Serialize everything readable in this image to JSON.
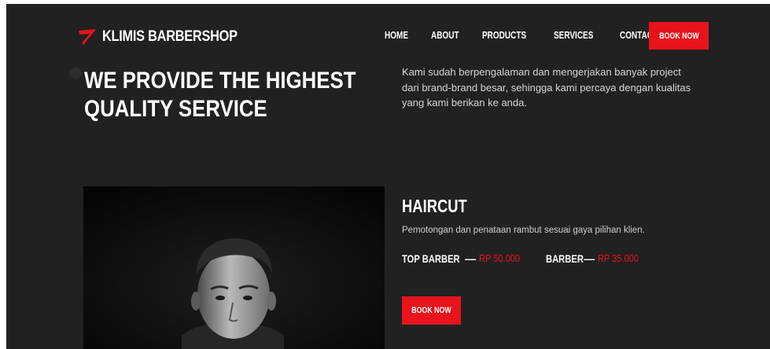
{
  "brand": {
    "name": "KLIMIS BARBERSHOP",
    "accent": "#e8131c"
  },
  "nav": {
    "items": [
      "HOME",
      "ABOUT",
      "PRODUCTS",
      "SERVICES",
      "CONTACTS"
    ],
    "cta": "BOOK NOW"
  },
  "hero": {
    "title": "WE PROVIDE THE HIGHEST QUALITY SERVICE",
    "intro": "Kami sudah berpengalaman dan mengerjakan banyak project dari brand-brand besar, sehingga kami percaya dengan kualitas yang kami berikan ke anda."
  },
  "service": {
    "title": "HAIRCUT",
    "description": "Pemotongan dan penataan rambut sesuai gaya pilihan klien.",
    "prices": [
      {
        "label": "TOP BARBER",
        "separator": "—",
        "value": "RP 50.000"
      },
      {
        "label": "BARBER",
        "separator": "—",
        "value": "RP 35.000"
      }
    ],
    "cta": "BOOK NOW"
  }
}
